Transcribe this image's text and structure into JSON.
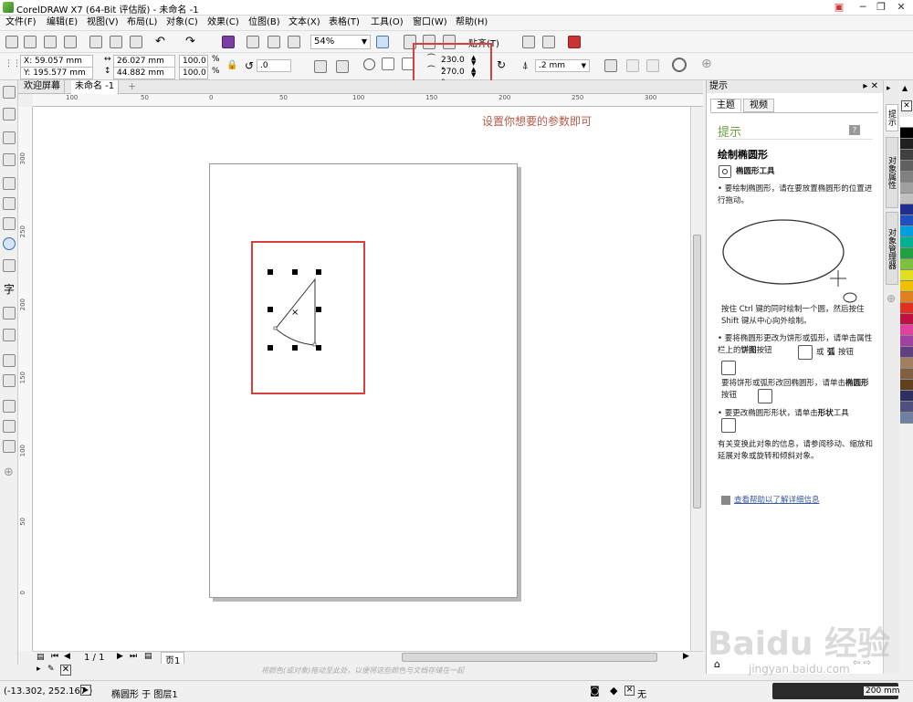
{
  "window": {
    "title": "CorelDRAW X7 (64-Bit 评估版) - 未命名 -1"
  },
  "menu": [
    "文件(F)",
    "编辑(E)",
    "视图(V)",
    "布局(L)",
    "对象(C)",
    "效果(C)",
    "位图(B)",
    "文本(X)",
    "表格(T)",
    "工具(O)",
    "窗口(W)",
    "帮助(H)"
  ],
  "toolbar": {
    "zoom": "54%",
    "snap_label": "贴齐(T)"
  },
  "property_bar": {
    "x": "X: 59.057 mm",
    "y": "Y: 195.577 mm",
    "width": "26.027 mm",
    "height": "44.882 mm",
    "scale_x": "100.0",
    "scale_y": "100.0",
    "percent": "%",
    "rotation": ".0",
    "start_angle": "230.0 °",
    "end_angle": "270.0 °",
    "outline_width": ".2 mm"
  },
  "doc_tabs": [
    "欢迎屏幕",
    "未命名 -1"
  ],
  "ruler_h": [
    "100",
    "50",
    "0",
    "50",
    "100",
    "150",
    "200",
    "250",
    "300"
  ],
  "ruler_v": [
    "300",
    "250",
    "200",
    "150",
    "100",
    "50",
    "0"
  ],
  "annotation": "设置你想要的参数即可",
  "page_nav": {
    "pages": "1 / 1",
    "page_tab": "页1"
  },
  "status": {
    "coords": "(-13.302, 252.167 )",
    "object_info": "椭圆形 于 图层1",
    "drag_hint": "将颜色(或对象)拖动至此处，以便将这些颜色与文档存储在一起",
    "fill_none": "无",
    "outline_width": "200 mm"
  },
  "docker": {
    "header": "提示",
    "tabs": [
      "主题",
      "视频"
    ],
    "section_title": "提示",
    "heading": "绘制椭圆形",
    "tool_name": "椭圆形工具",
    "p1": "• 要绘制椭圆形，请在要放置椭圆形的位置进行拖动。",
    "p2": "按住 Ctrl 键的同时绘制一个圆，然后按住 Shift 键从中心向外绘制。",
    "p3a": "• 要将椭圆形更改为饼形或弧形，请单击属性栏上的",
    "p3b": "饼图",
    "p3c": "按钮",
    "p3d": "或",
    "p3e": "弧",
    "p3f": "按钮",
    "p4a": "要将饼形或弧形改回椭圆形，请单击",
    "p4b": "椭圆形",
    "p4c": "按钮",
    "p5a": "• 要更改椭圆形形状，请单击",
    "p5b": "形状",
    "p5c": "工具",
    "p6": "有关变换此对象的信息，请参阅移动、缩放和延展对象或旋转和倾斜对象。",
    "link": "查看帮助以了解详细信息"
  },
  "vtabs": [
    "提示",
    "对象属性",
    "对象管理器"
  ],
  "palette_colors": [
    "#ffffff",
    "#000000",
    "#202020",
    "#404040",
    "#606060",
    "#808080",
    "#a0a0a0",
    "#c0c0c0",
    "#1f2f8f",
    "#2050c0",
    "#00a0e0",
    "#00b090",
    "#20a040",
    "#80c040",
    "#e0e020",
    "#f0c000",
    "#e08020",
    "#e03020",
    "#c01040",
    "#e040a0",
    "#a040a0",
    "#604080",
    "#a08060",
    "#806040",
    "#604020",
    "#303060",
    "#505080",
    "#7080a0"
  ],
  "watermark": "Baidu 经验",
  "watermark_url": "jingyan.baidu.com"
}
